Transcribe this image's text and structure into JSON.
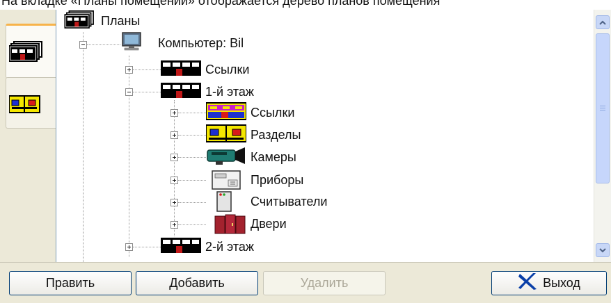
{
  "caption": "На вкладке «Планы помещений» отображается дерево планов помещения",
  "side_tabs": [
    {
      "name": "plans-tab",
      "icon": "plan-icon",
      "active": true
    },
    {
      "name": "sections-tab",
      "icon": "sections-icon",
      "active": false
    }
  ],
  "tree": {
    "root": {
      "label": "Планы",
      "icon": "plan-icon"
    },
    "computer": {
      "label": "Компьютер: Bil",
      "icon": "computer-icon"
    },
    "links_top": {
      "label": "Ссылки",
      "icon": "plan-icon"
    },
    "floor1": {
      "label": "1-й этаж",
      "icon": "plan-icon"
    },
    "floor1_children": [
      {
        "label": "Ссылки",
        "icon": "links-color-icon"
      },
      {
        "label": "Разделы",
        "icon": "sections-icon"
      },
      {
        "label": "Камеры",
        "icon": "camera-icon"
      },
      {
        "label": "Приборы",
        "icon": "device-icon"
      },
      {
        "label": "Считыватели",
        "icon": "reader-icon"
      },
      {
        "label": "Двери",
        "icon": "door-icon"
      }
    ],
    "floor2": {
      "label": "2-й этаж",
      "icon": "plan-icon"
    }
  },
  "buttons": {
    "edit": "Править",
    "add": "Добавить",
    "delete": "Удалить",
    "exit": "Выход"
  },
  "colors": {
    "accent_tab": "#f7b34a",
    "exit_icon": "#0a3fa8"
  }
}
